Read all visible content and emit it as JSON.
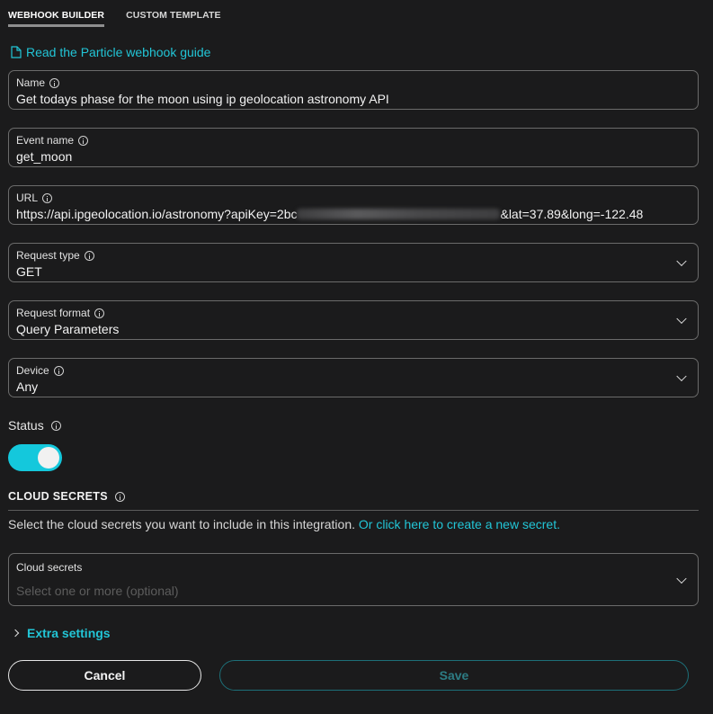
{
  "tabs": [
    {
      "label": "WEBHOOK BUILDER",
      "active": true
    },
    {
      "label": "CUSTOM TEMPLATE",
      "active": false
    }
  ],
  "guide_link": {
    "label": "Read the Particle webhook guide",
    "icon": "document-icon"
  },
  "fields": {
    "name": {
      "label": "Name",
      "value": "Get todays phase for the moon using ip geolocation astronomy API"
    },
    "event_name": {
      "label": "Event name",
      "value": "get_moon"
    },
    "url": {
      "label": "URL",
      "value_prefix": "https://api.ipgeolocation.io/astronomy?apiKey=2bc",
      "value_suffix": "&lat=37.89&long=-122.48"
    },
    "request_type": {
      "label": "Request type",
      "value": "GET"
    },
    "request_format": {
      "label": "Request format",
      "value": "Query Parameters"
    },
    "device": {
      "label": "Device",
      "value": "Any"
    }
  },
  "status": {
    "label": "Status",
    "enabled": true
  },
  "cloud_secrets": {
    "heading": "CLOUD SECRETS",
    "description": "Select the cloud secrets you want to include in this integration.",
    "link": "Or click here to create a new secret.",
    "field_label": "Cloud secrets",
    "placeholder": "Select one or more (optional)"
  },
  "extra_settings": {
    "label": "Extra settings"
  },
  "buttons": {
    "cancel": "Cancel",
    "save": "Save"
  },
  "colors": {
    "accent": "#22c5d6",
    "toggle_on": "#14c8dc",
    "background": "#1b1b1c",
    "border": "#6b6b6b"
  }
}
